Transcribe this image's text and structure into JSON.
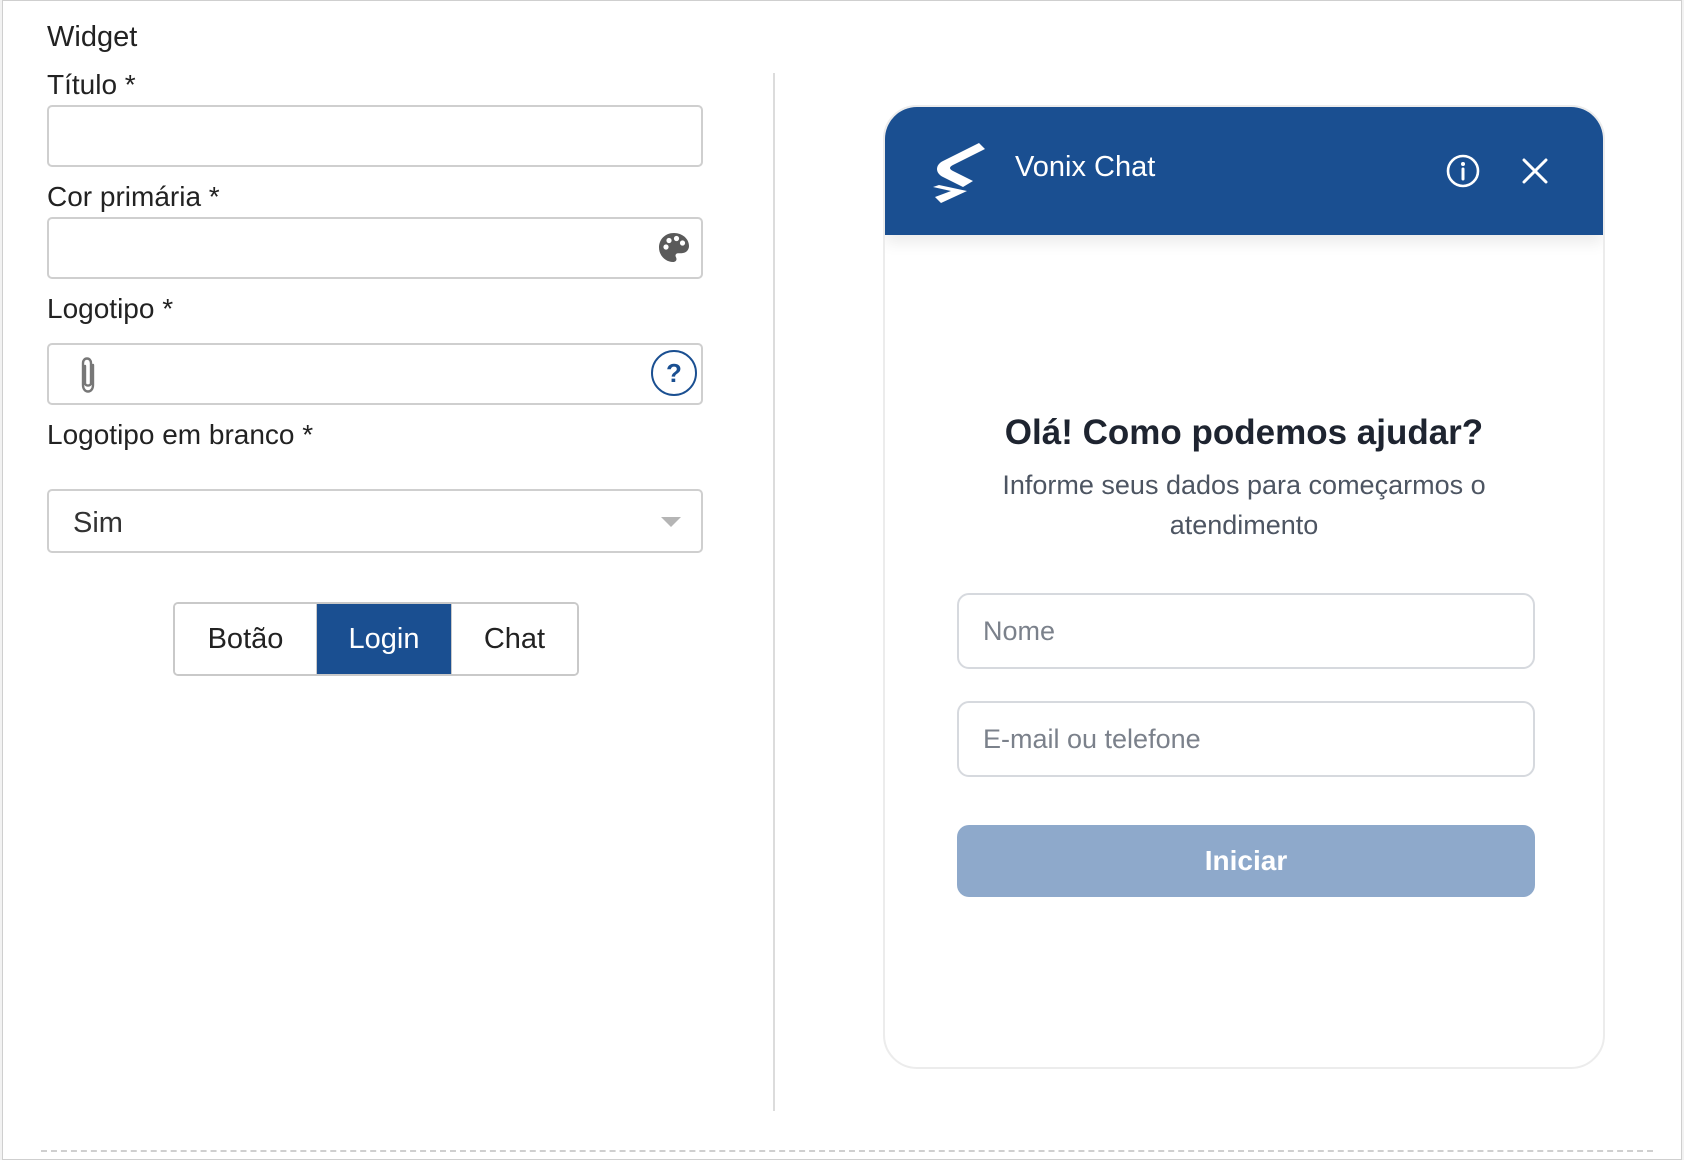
{
  "form": {
    "section_title": "Widget",
    "title_label": "Título *",
    "title_value": "",
    "color_label": "Cor primária *",
    "color_value": "",
    "logo_label": "Logotipo *",
    "logo_value": "",
    "logo_help": "?",
    "white_logo_label": "Logotipo em branco *",
    "white_logo_value": "Sim",
    "tabs": [
      {
        "label": "Botão",
        "active": false
      },
      {
        "label": "Login",
        "active": true
      },
      {
        "label": "Chat",
        "active": false
      }
    ]
  },
  "preview": {
    "header_title": "Vonix Chat",
    "welcome_title": "Olá! Como podemos ajudar?",
    "welcome_subtitle": "Informe seus dados para começarmos o atendimento",
    "name_placeholder": "Nome",
    "contact_placeholder": "E-mail ou telefone",
    "start_label": "Iniciar"
  },
  "colors": {
    "primary": "#1a4f91",
    "button_disabled": "#8ea9cb",
    "border": "#cfcfcf"
  },
  "icons": {
    "palette": "palette-icon",
    "attachment": "paperclip-icon",
    "help": "question-circle-icon",
    "dropdown": "caret-down-icon",
    "logo": "vonix-logo",
    "info": "info-circle-icon",
    "close": "close-icon"
  }
}
